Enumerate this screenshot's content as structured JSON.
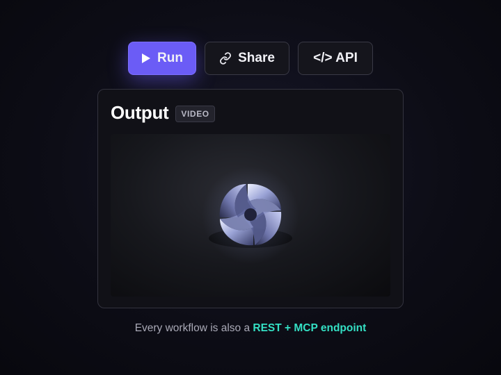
{
  "toolbar": {
    "run": {
      "label": "Run",
      "icon": "play-icon"
    },
    "share": {
      "label": "Share",
      "icon": "link-icon"
    },
    "api": {
      "label": "</> API"
    }
  },
  "output": {
    "title": "Output",
    "badge": "VIDEO",
    "media_icon": "swirl-logo"
  },
  "footer": {
    "text": "Every workflow is also a ",
    "highlight": "REST + MCP endpoint"
  },
  "colors": {
    "accent": "#6b5cf6",
    "highlight": "#34e0c4",
    "background": "#0d0d16"
  }
}
